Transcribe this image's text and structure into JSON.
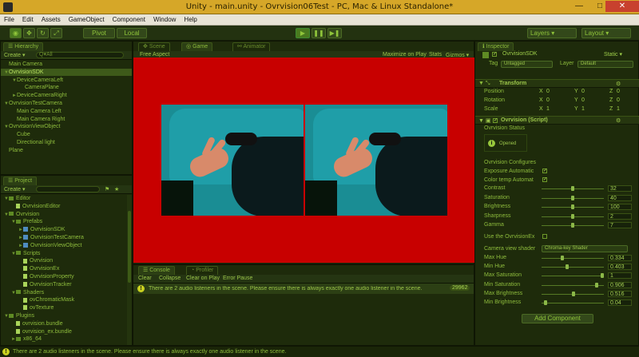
{
  "window": {
    "title": "Unity - main.unity - Ovrvision06Test - PC, Mac & Linux Standalone*",
    "minimize": "—",
    "maximize": "□",
    "close": "✕"
  },
  "menu": [
    "File",
    "Edit",
    "Assets",
    "GameObject",
    "Component",
    "Window",
    "Help"
  ],
  "toolbar": {
    "pivot": "Pivot",
    "local": "Local",
    "layers": "Layers",
    "layout": "Layout"
  },
  "hierarchy": {
    "tab": "Hierarchy",
    "create": "Create ▾",
    "search_placeholder": "Q▾All",
    "items": [
      {
        "label": "Main Camera",
        "indent": 0,
        "arrow": "",
        "selected": false
      },
      {
        "label": "OvrvisionSDK",
        "indent": 0,
        "arrow": "▼",
        "selected": true
      },
      {
        "label": "DeviceCameraLeft",
        "indent": 1,
        "arrow": "▼",
        "selected": false
      },
      {
        "label": "CameraPlane",
        "indent": 2,
        "arrow": "",
        "selected": false
      },
      {
        "label": "DeviceCameraRight",
        "indent": 1,
        "arrow": "►",
        "selected": false
      },
      {
        "label": "OvrvisionTestCamera",
        "indent": 0,
        "arrow": "▼",
        "selected": false
      },
      {
        "label": "Main Camera Left",
        "indent": 1,
        "arrow": "",
        "selected": false
      },
      {
        "label": "Main Camera Right",
        "indent": 1,
        "arrow": "",
        "selected": false
      },
      {
        "label": "OvrvisionViewObject",
        "indent": 0,
        "arrow": "▼",
        "selected": false
      },
      {
        "label": "Cube",
        "indent": 1,
        "arrow": "",
        "selected": false
      },
      {
        "label": "Directional light",
        "indent": 1,
        "arrow": "",
        "selected": false
      },
      {
        "label": "Plane",
        "indent": 0,
        "arrow": "",
        "selected": false
      }
    ]
  },
  "project": {
    "tab": "Project",
    "create": "Create ▾",
    "items": [
      {
        "label": "Editor",
        "indent": 0,
        "icon": "folder",
        "arrow": "▼"
      },
      {
        "label": "OvrvisionEditor",
        "indent": 1,
        "icon": "script",
        "arrow": ""
      },
      {
        "label": "Ovrvision",
        "indent": 0,
        "icon": "folder",
        "arrow": "▼"
      },
      {
        "label": "Prefabs",
        "indent": 1,
        "icon": "folder",
        "arrow": "▼"
      },
      {
        "label": "OvrvisionSDK",
        "indent": 2,
        "icon": "prefab",
        "arrow": "►"
      },
      {
        "label": "OvrvisionTestCamera",
        "indent": 2,
        "icon": "prefab",
        "arrow": "►"
      },
      {
        "label": "OvrvisionViewObject",
        "indent": 2,
        "icon": "prefab",
        "arrow": "►"
      },
      {
        "label": "Scripts",
        "indent": 1,
        "icon": "folder",
        "arrow": "▼"
      },
      {
        "label": "Ovrvision",
        "indent": 2,
        "icon": "script",
        "arrow": ""
      },
      {
        "label": "OvrvisionEx",
        "indent": 2,
        "icon": "script",
        "arrow": ""
      },
      {
        "label": "OvrvisionProperty",
        "indent": 2,
        "icon": "script",
        "arrow": ""
      },
      {
        "label": "OvrvisionTracker",
        "indent": 2,
        "icon": "script",
        "arrow": ""
      },
      {
        "label": "Shaders",
        "indent": 1,
        "icon": "folder",
        "arrow": "▼"
      },
      {
        "label": "ovChromaticMask",
        "indent": 2,
        "icon": "script",
        "arrow": ""
      },
      {
        "label": "ovTexture",
        "indent": 2,
        "icon": "script",
        "arrow": ""
      },
      {
        "label": "Plugins",
        "indent": 0,
        "icon": "folder",
        "arrow": "▼"
      },
      {
        "label": "ovrvision.bundle",
        "indent": 1,
        "icon": "script",
        "arrow": ""
      },
      {
        "label": "ovrvision_ex.bundle",
        "indent": 1,
        "icon": "script",
        "arrow": ""
      },
      {
        "label": "x86_64",
        "indent": 1,
        "icon": "folder",
        "arrow": "►"
      }
    ]
  },
  "center_tabs": {
    "scene": "Scene",
    "game": "Game",
    "animator": "Animator"
  },
  "game_bar": {
    "aspect": "Free Aspect",
    "maximize": "Maximize on Play",
    "stats": "Stats",
    "gizmos": "Gizmos ▾"
  },
  "console": {
    "tab": "Console",
    "profiler_tab": "Profiler",
    "buttons": [
      "Clear",
      "Collapse",
      "Clear on Play",
      "Error Pause"
    ],
    "message": "There are 2 audio listeners in the scene. Please ensure there is always exactly one audio listener in the scene.",
    "count": "29962"
  },
  "inspector": {
    "tab": "Inspector",
    "object_name": "OvrvisionSDK",
    "static": "Static ▾",
    "tag_label": "Tag",
    "tag_value": "Untagged",
    "layer_label": "Layer",
    "layer_value": "Default",
    "transform": {
      "header": "Transform",
      "rows": [
        {
          "label": "Position",
          "x": "0",
          "y": "0",
          "z": "0"
        },
        {
          "label": "Rotation",
          "x": "0",
          "y": "0",
          "z": "0"
        },
        {
          "label": "Scale",
          "x": "1",
          "y": "1",
          "z": "1"
        }
      ]
    },
    "script": {
      "header": "Ovrvision (Script)",
      "status_label": "Ovrvision Status",
      "status_value": "Opened",
      "configures": "Ovrvision Configures",
      "exposure": "Exposure Automatic",
      "colortemp": "Color temp Automat",
      "sliders": [
        {
          "label": "Contrast",
          "value": "32",
          "fraction": 0.5
        },
        {
          "label": "Saturation",
          "value": "40",
          "fraction": 0.5
        },
        {
          "label": "Brightness",
          "value": "100",
          "fraction": 0.5
        },
        {
          "label": "Sharpness",
          "value": "2",
          "fraction": 0.5
        },
        {
          "label": "Gamma",
          "value": "7",
          "fraction": 0.5
        }
      ],
      "use_ex": "Use the OvrvisionEx",
      "shader_label": "Camera view shader",
      "shader_value": "Chroma-key Shader",
      "shader_sliders": [
        {
          "label": "Max Hue",
          "value": "0.334",
          "fraction": 0.33
        },
        {
          "label": "Min Hue",
          "value": "0.403",
          "fraction": 0.4
        },
        {
          "label": "Max Saturation",
          "value": "1",
          "fraction": 1.0
        },
        {
          "label": "Min Saturation",
          "value": "0.906",
          "fraction": 0.9
        },
        {
          "label": "Max Brightness",
          "value": "0.516",
          "fraction": 0.52
        },
        {
          "label": "Min Brightness",
          "value": "0.04",
          "fraction": 0.04
        }
      ]
    },
    "add_component": "Add Component"
  },
  "status": {
    "message": "There are 2 audio listeners in the scene. Please ensure there is always exactly one audio listener in the scene."
  },
  "colors": {
    "accent": "#9cc64a",
    "game_bg": "#c80000",
    "titlebar": "#d6a728"
  }
}
